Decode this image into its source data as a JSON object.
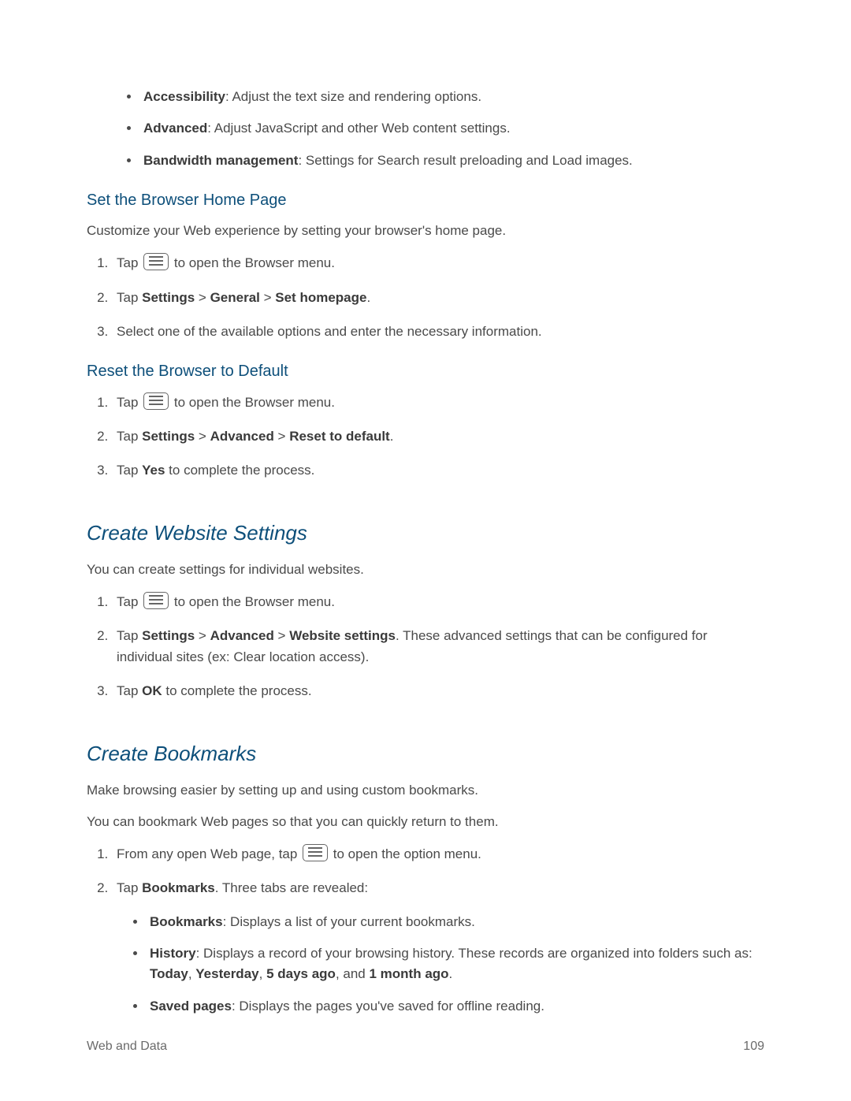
{
  "bullets_top": [
    {
      "bold": "Accessibility",
      "text": ": Adjust the text size and rendering options."
    },
    {
      "bold": "Advanced",
      "text": ": Adjust JavaScript and other Web content settings."
    },
    {
      "bold": "Bandwidth management",
      "text": ": Settings for Search result preloading and Load images."
    }
  ],
  "sec1": {
    "heading": "Set the Browser Home Page",
    "intro": "Customize your Web experience by setting your browser's home page.",
    "steps": {
      "s1_pre": "Tap ",
      "s1_post": " to open the Browser menu.",
      "s2_pre": "Tap ",
      "s2_b1": "Settings",
      "s2_sep": " > ",
      "s2_b2": "General",
      "s2_b3": "Set homepage",
      "s2_end": ".",
      "s3": "Select one of the available options and enter the necessary information."
    }
  },
  "sec2": {
    "heading": "Reset the Browser to Default",
    "steps": {
      "s1_pre": "Tap ",
      "s1_post": " to open the Browser menu.",
      "s2_pre": "Tap ",
      "s2_b1": "Settings",
      "s2_sep": " > ",
      "s2_b2": "Advanced",
      "s2_b3": "Reset to default",
      "s2_end": ".",
      "s3_pre": "Tap ",
      "s3_b": "Yes",
      "s3_post": " to complete the process."
    }
  },
  "sec3": {
    "heading": "Create Website Settings",
    "intro": "You can create settings for individual websites.",
    "steps": {
      "s1_pre": "Tap ",
      "s1_post": " to open the Browser menu.",
      "s2_pre": "Tap ",
      "s2_b1": "Settings",
      "s2_sep": " > ",
      "s2_b2": "Advanced",
      "s2_b3": "Website settings",
      "s2_post": ". These advanced settings that can be configured for individual sites (ex: Clear location access).",
      "s3_pre": "Tap ",
      "s3_b": "OK",
      "s3_post": " to complete the process."
    }
  },
  "sec4": {
    "heading": "Create Bookmarks",
    "intro1": "Make browsing easier by setting up and using custom bookmarks.",
    "intro2": "You can bookmark Web pages so that you can quickly return to them.",
    "steps": {
      "s1_pre": "From any open Web page, tap ",
      "s1_post": " to open the option menu.",
      "s2_pre": "Tap ",
      "s2_b": "Bookmarks",
      "s2_post": ". Three tabs are revealed:"
    },
    "tabs": {
      "t1_b": "Bookmarks",
      "t1_post": ": Displays a list of your current bookmarks.",
      "t2_b": "History",
      "t2_mid1": ": Displays a record of your browsing history. These records are organized into folders such as: ",
      "t2_b1": "Today",
      "t2_c": ", ",
      "t2_b2": "Yesterday",
      "t2_b3": "5 days ago",
      "t2_and": ", and ",
      "t2_b4": "1 month ago",
      "t2_end": ".",
      "t3_b": "Saved pages",
      "t3_post": ": Displays the pages you've saved for offline reading."
    }
  },
  "footer": {
    "left": "Web and Data",
    "right": "109"
  }
}
